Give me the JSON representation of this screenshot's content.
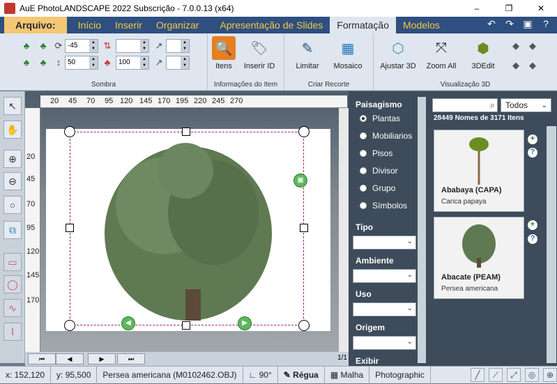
{
  "window": {
    "title": "AuE PhotoLANDSCAPE 2022 Subscrição - 7.0.0.13 (x64)",
    "min": "–",
    "max": "❐",
    "close": "✕"
  },
  "menu": {
    "file": "Arquivo:",
    "items": [
      "Início",
      "Inserir",
      "Organizar",
      "Apresentação de Slides",
      "Formatação",
      "Modelos"
    ],
    "active": "Formatação"
  },
  "ribbon": {
    "sombra": {
      "label": "Sombra",
      "value1": "-45",
      "value2": "50",
      "value3": "100"
    },
    "info": {
      "label": "Informações do Item",
      "itens": "Itens",
      "inserir_id": "Inserir ID"
    },
    "recorte": {
      "label": "Criar Recorte",
      "limitar": "Limitar",
      "mosaico": "Mosaico"
    },
    "viz3d": {
      "label": "Visualização 3D",
      "ajustar": "Ajustar 3D",
      "zoom": "Zoom All",
      "edit": "3DEdit"
    }
  },
  "ruler": {
    "top": [
      "20",
      "45",
      "70",
      "95",
      "120",
      "145",
      "170",
      "195",
      "220",
      "245",
      "270"
    ],
    "left": [
      "20",
      "45",
      "70",
      "95",
      "120",
      "145",
      "170"
    ]
  },
  "mid": {
    "paisagismo": "Paisagismo",
    "options": [
      "Plantas",
      "Mobiliarios",
      "Pisos",
      "Divisor",
      "Grupo",
      "Símbolos"
    ],
    "selected": "Plantas",
    "tipo": "Tipo",
    "ambiente": "Ambiente",
    "uso": "Uso",
    "origem": "Origem",
    "exibir": "Exibir"
  },
  "right": {
    "filter": "Todos",
    "count": "28449 Nomes de 3171 Itens",
    "cards": [
      {
        "name": "Ababaya (CAPA)",
        "sci": "Carica papaya"
      },
      {
        "name": "Abacate (PEAM)",
        "sci": "Persea americana"
      }
    ]
  },
  "page_indicator": "1/1",
  "status": {
    "x": "x: 152,120",
    "y": "y: 95,500",
    "file": "Persea americana (M0102462.OBJ)",
    "angle": "90°",
    "regua": "Régua",
    "malha": "Malha",
    "mode": "Photographic"
  }
}
